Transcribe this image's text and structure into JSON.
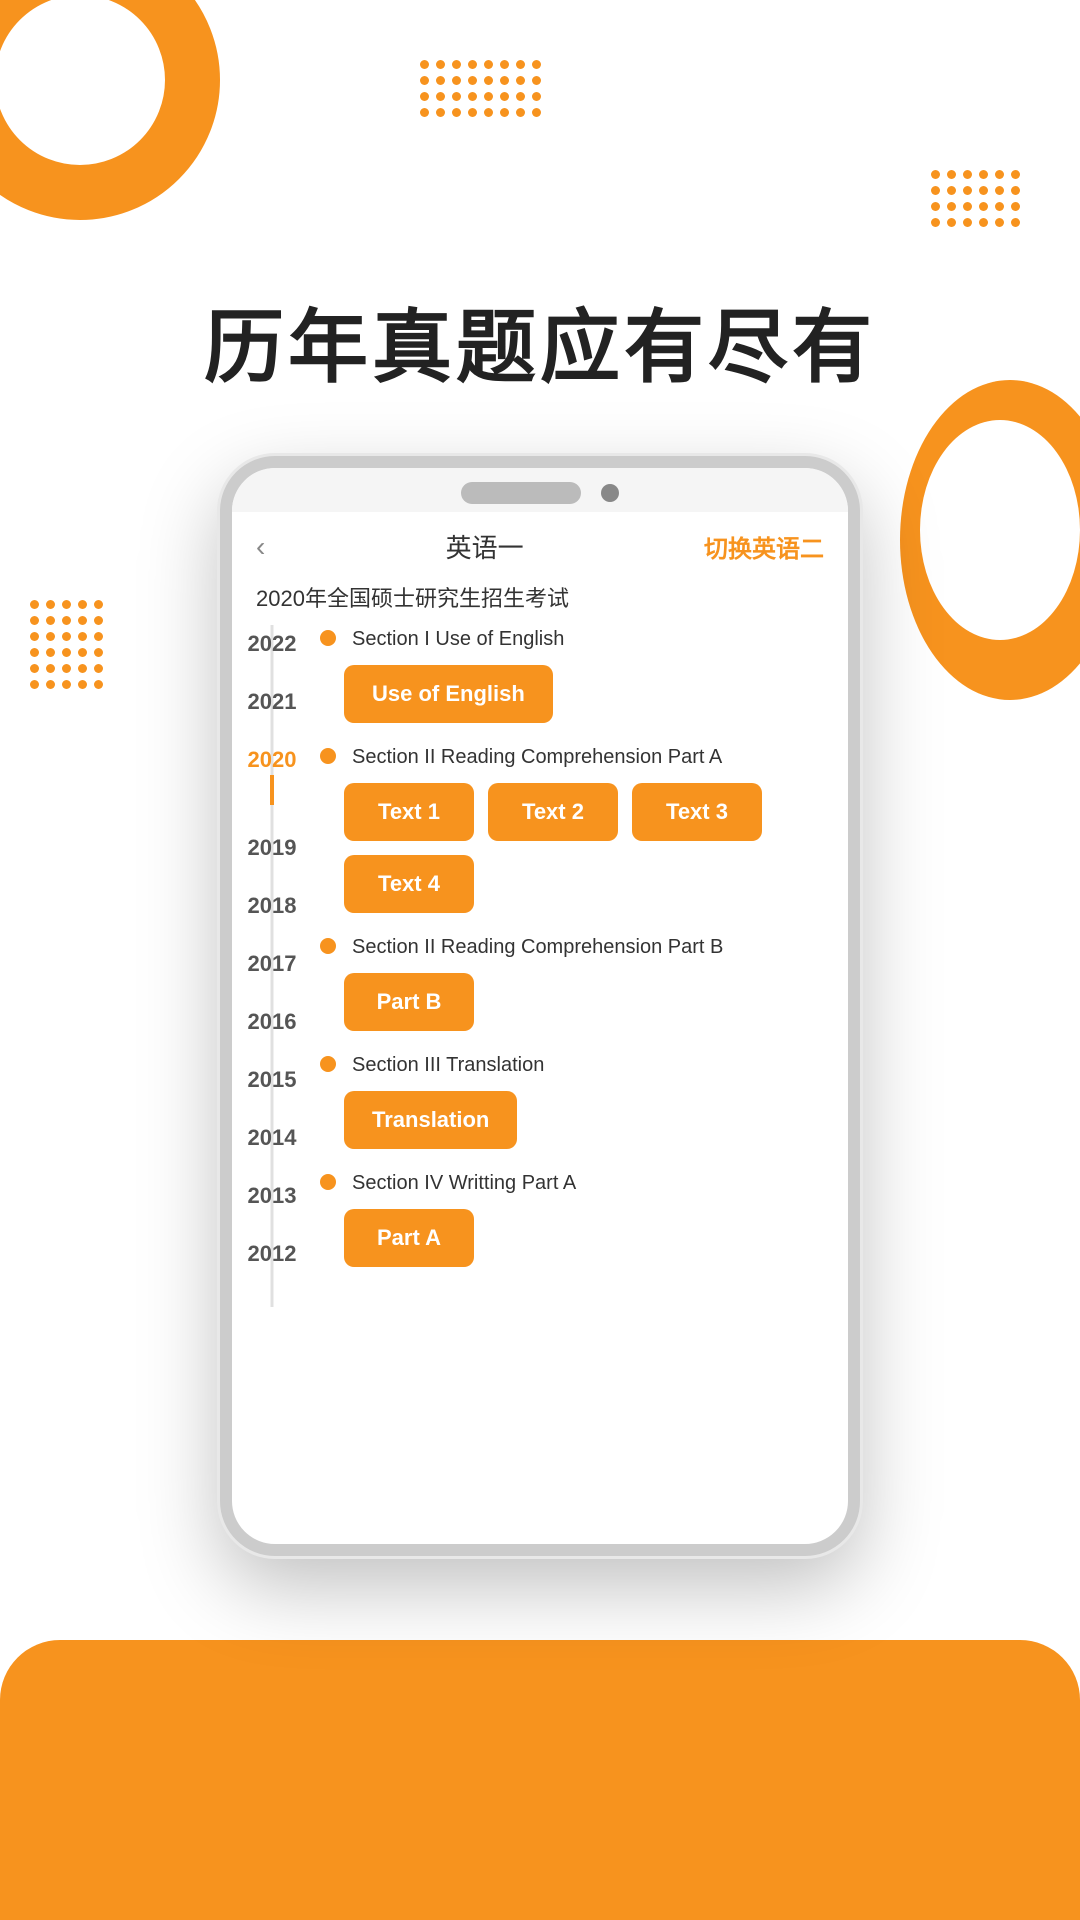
{
  "hero": {
    "title": "历年真题应有尽有"
  },
  "decoration": {
    "dots_top_cols": 8,
    "dots_top_rows": 4,
    "dots_right_cols": 6,
    "dots_right_rows": 4,
    "dots_left_cols": 5,
    "dots_left_rows": 6
  },
  "phone": {
    "back_label": "‹",
    "nav_title": "英语一",
    "nav_switch": "切换英语二",
    "exam_title": "2020年全国硕士研究生招生考试",
    "years": [
      "2022",
      "2021",
      "2020",
      "2019",
      "2018",
      "2017",
      "2016",
      "2015",
      "2014",
      "2013",
      "2012"
    ],
    "active_year": "2020",
    "sections": [
      {
        "id": "sec1",
        "header": "Section I Use of English",
        "buttons": [
          "Use of English"
        ]
      },
      {
        "id": "sec2",
        "header": "Section II Reading Comprehension Part A",
        "buttons": [
          "Text 1",
          "Text 2",
          "Text 3",
          "Text 4"
        ]
      },
      {
        "id": "sec3",
        "header": "Section II Reading Comprehension Part B",
        "buttons": [
          "Part B"
        ]
      },
      {
        "id": "sec4",
        "header": "Section III Translation",
        "buttons": [
          "Translation"
        ]
      },
      {
        "id": "sec5",
        "header": "Section IV Writting Part A",
        "buttons": [
          "Part A"
        ]
      }
    ]
  }
}
